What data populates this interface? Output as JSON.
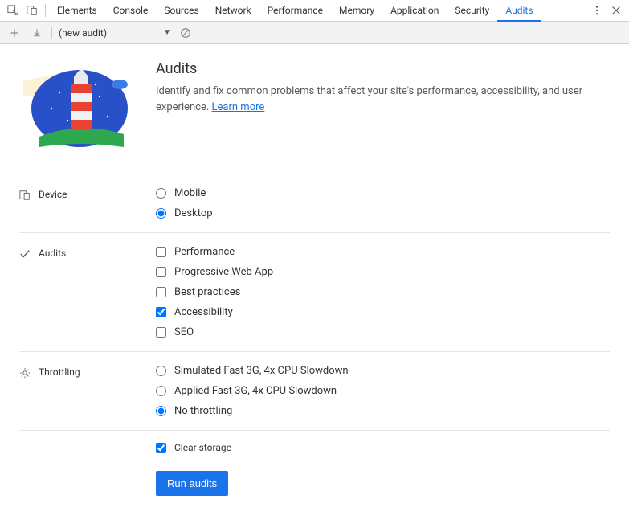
{
  "tabs": [
    "Elements",
    "Console",
    "Sources",
    "Network",
    "Performance",
    "Memory",
    "Application",
    "Security",
    "Audits"
  ],
  "activeTab": "Audits",
  "auditSelect": "(new audit)",
  "page": {
    "title": "Audits",
    "description": "Identify and fix common problems that affect your site's performance, accessibility, and user experience. ",
    "learnMore": "Learn more"
  },
  "sections": {
    "device": {
      "label": "Device",
      "options": [
        {
          "label": "Mobile",
          "checked": false
        },
        {
          "label": "Desktop",
          "checked": true
        }
      ]
    },
    "audits": {
      "label": "Audits",
      "options": [
        {
          "label": "Performance",
          "checked": false
        },
        {
          "label": "Progressive Web App",
          "checked": false
        },
        {
          "label": "Best practices",
          "checked": false
        },
        {
          "label": "Accessibility",
          "checked": true
        },
        {
          "label": "SEO",
          "checked": false
        }
      ]
    },
    "throttling": {
      "label": "Throttling",
      "options": [
        {
          "label": "Simulated Fast 3G, 4x CPU Slowdown",
          "checked": false
        },
        {
          "label": "Applied Fast 3G, 4x CPU Slowdown",
          "checked": false
        },
        {
          "label": "No throttling",
          "checked": true
        }
      ]
    },
    "clearStorage": {
      "label": "Clear storage",
      "checked": true
    }
  },
  "runButton": "Run audits"
}
